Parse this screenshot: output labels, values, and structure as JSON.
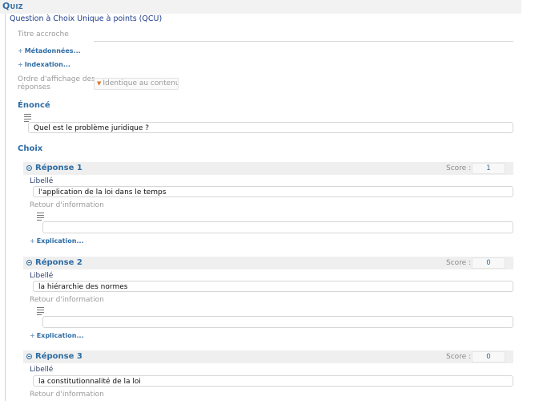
{
  "header": {
    "title": "Quiz"
  },
  "question_type": "Question à Choix Unique à points (QCU)",
  "titre_accroche": {
    "label": "Titre accroche",
    "value": ""
  },
  "expanders": {
    "metadonnees": "Métadonnées...",
    "indexation": "Indexation..."
  },
  "ordre": {
    "label_line1": "Ordre d'affichage des",
    "label_line2": "réponses",
    "value": "Identique au contenu"
  },
  "enonce": {
    "title": "Énoncé",
    "text": "Quel est le problème juridique ?"
  },
  "choix": {
    "title": "Choix",
    "responses": [
      {
        "title": "Réponse 1",
        "score_label": "Score :",
        "score": "1",
        "libelle_label": "Libellé",
        "libelle": "l'application de la loi dans le temps",
        "retour_label": "Retour d'information",
        "retour": "",
        "explication": "Explication..."
      },
      {
        "title": "Réponse 2",
        "score_label": "Score :",
        "score": "0",
        "libelle_label": "Libellé",
        "libelle": "la hiérarchie des normes",
        "retour_label": "Retour d'information",
        "retour": "",
        "explication": "Explication..."
      },
      {
        "title": "Réponse 3",
        "score_label": "Score :",
        "score": "0",
        "libelle_label": "Libellé",
        "libelle": "la constitutionnalité de la loi",
        "retour_label": "Retour d'information"
      }
    ]
  },
  "colors": {
    "accent": "#2e6ca4",
    "header_bg": "#f2f2f2",
    "response_bar_bg": "#efefef"
  },
  "icons": {
    "expander": "plus-icon",
    "paragraph": "paragraph-lines-icon",
    "response": "collapse-circle-icon",
    "select": "dropdown-arrow-icon"
  }
}
